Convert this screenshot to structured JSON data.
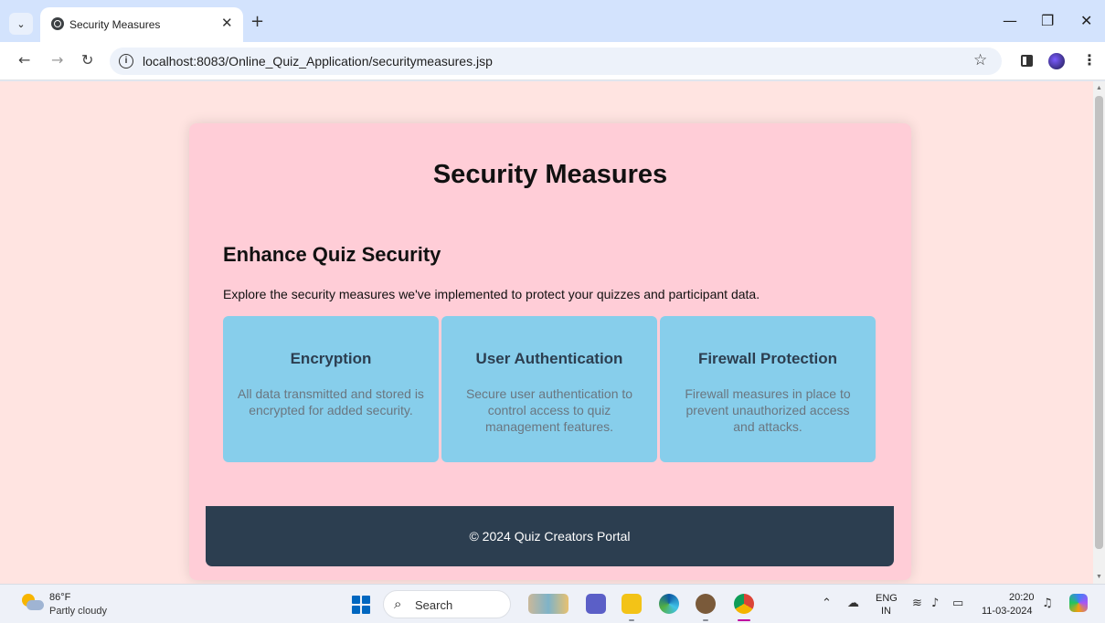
{
  "browser": {
    "tab_title": "Security Measures",
    "url": "localhost:8083/Online_Quiz_Application/securitymeasures.jsp",
    "icons": {
      "tab_menu": "chevron-down-icon",
      "close_tab": "close-icon",
      "new_tab": "plus-icon",
      "back": "arrow-left-icon",
      "forward": "arrow-right-icon",
      "reload": "reload-icon",
      "site_info": "info-icon",
      "bookmark": "star-icon",
      "menu": "kebab-icon"
    }
  },
  "page": {
    "title": "Security Measures",
    "section_title": "Enhance Quiz Security",
    "section_description": "Explore the security measures we've implemented to protect your quizzes and participant data.",
    "features": [
      {
        "title": "Encryption",
        "text": "All data transmitted and stored is encrypted for added security."
      },
      {
        "title": "User Authentication",
        "text": "Secure user authentication to control access to quiz management features."
      },
      {
        "title": "Firewall Protection",
        "text": "Firewall measures in place to prevent unauthorized access and attacks."
      }
    ],
    "footer": "© 2024 Quiz Creators Portal",
    "colors": {
      "background": "#ffe4e1",
      "card": "#ffcdd7",
      "feature": "#87ceeb",
      "footer": "#2c3e50"
    }
  },
  "taskbar": {
    "weather_temp": "86°F",
    "weather_desc": "Partly cloudy",
    "search_label": "Search",
    "lang_top": "ENG",
    "lang_bottom": "IN",
    "time": "20:20",
    "date": "11-03-2024"
  }
}
